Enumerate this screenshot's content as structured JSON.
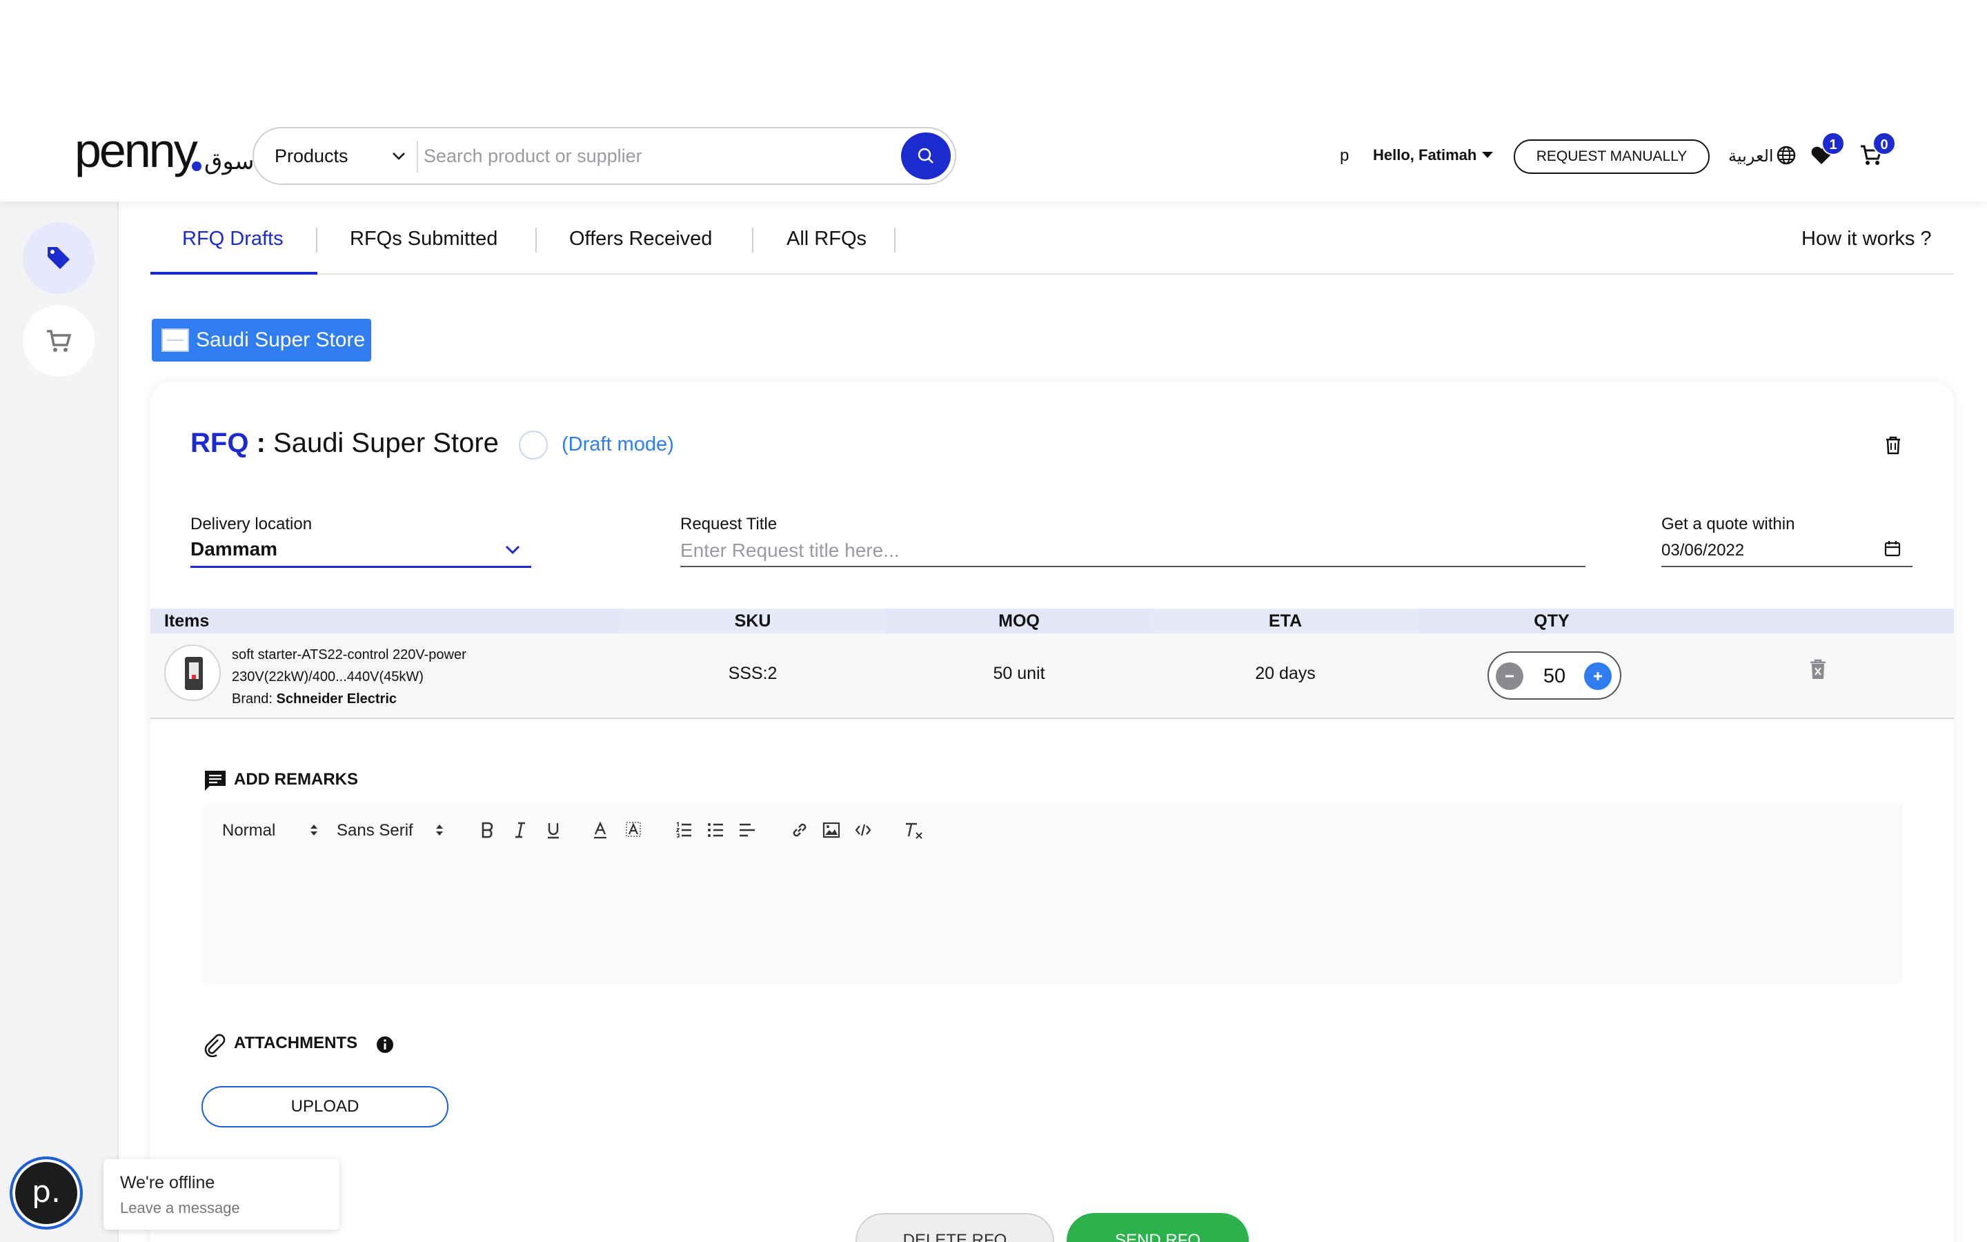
{
  "colors": {
    "brand": "#1c2bd0",
    "accent": "#2f7df0",
    "send": "#2bb24c",
    "header_row": "#e4e6f7"
  },
  "header": {
    "logo_text": "penny",
    "logo_sub": "سوق",
    "search": {
      "category": "Products",
      "placeholder": "Search product or supplier",
      "button_icon": "search-icon"
    },
    "user_initial": "p",
    "greeting": "Hello, Fatimah",
    "request_manually": "REQUEST MANUALLY",
    "language": "العربية",
    "favorites_count": "1",
    "cart_count": "0"
  },
  "sidebar": {
    "items": [
      {
        "icon": "tag-icon",
        "active": true
      },
      {
        "icon": "cart-icon",
        "active": false
      }
    ]
  },
  "tabs": {
    "items": [
      {
        "label": "RFQ Drafts",
        "active": true
      },
      {
        "label": "RFQs Submitted"
      },
      {
        "label": "Offers Received"
      },
      {
        "label": "All RFQs"
      }
    ],
    "help": "How it works ?"
  },
  "store_chip": {
    "label": "Saudi Super Store"
  },
  "rfq": {
    "prefix": "RFQ",
    "separator": ":",
    "store_name": "Saudi Super Store",
    "mode": "(Draft mode)",
    "delivery": {
      "label": "Delivery location",
      "value": "Dammam"
    },
    "request_title": {
      "label": "Request Title",
      "placeholder": "Enter Request title here..."
    },
    "quote_within": {
      "label": "Get a quote within",
      "value": "03/06/2022"
    },
    "table": {
      "headers": [
        "Items",
        "SKU",
        "MOQ",
        "ETA",
        "QTY"
      ],
      "rows": [
        {
          "name_line1": "soft starter-ATS22-control 220V-power",
          "name_line2": "230V(22kW)/400...440V(45kW)",
          "brand_label": "Brand:",
          "brand": "Schneider Electric",
          "sku": "SSS:2",
          "moq": "50 unit",
          "eta": "20 days",
          "qty": "50"
        }
      ]
    },
    "remarks": {
      "title": "ADD REMARKS",
      "toolbar": {
        "size": "Normal",
        "font": "Sans Serif"
      }
    },
    "attachments": {
      "title": "ATTACHMENTS",
      "upload": "UPLOAD"
    },
    "actions": {
      "delete": "DELETE RFQ",
      "send": "SEND RFQ"
    }
  },
  "chat": {
    "avatar": "p.",
    "status": "We're offline",
    "cta": "Leave a message"
  }
}
